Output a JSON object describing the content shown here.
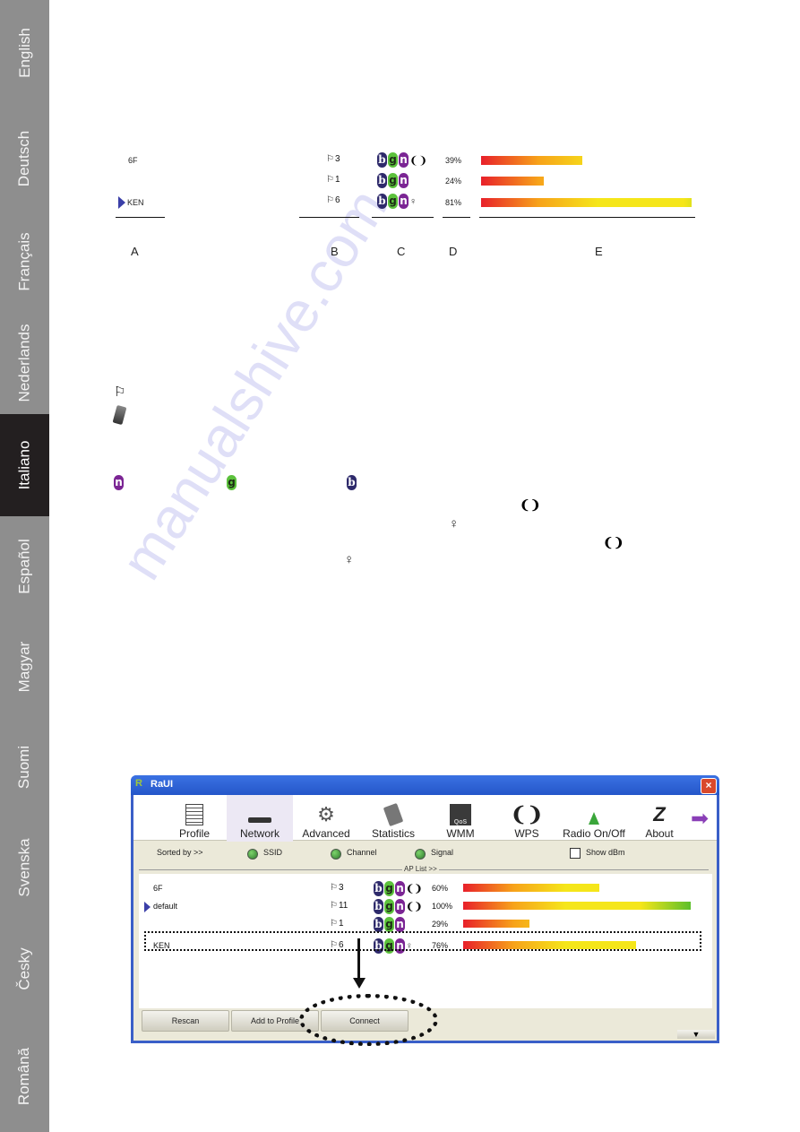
{
  "sidebar": {
    "languages": [
      {
        "label": "English",
        "active": false
      },
      {
        "label": "Deutsch",
        "active": false
      },
      {
        "label": "Français",
        "active": false
      },
      {
        "label": "Nederlands",
        "active": false
      },
      {
        "label": "Italiano",
        "active": true
      },
      {
        "label": "Español",
        "active": false
      },
      {
        "label": "Magyar",
        "active": false
      },
      {
        "label": "Suomi",
        "active": false
      },
      {
        "label": "Svenska",
        "active": false
      },
      {
        "label": "Česky",
        "active": false
      },
      {
        "label": "Română",
        "active": false
      }
    ]
  },
  "watermark": "manualshive.com",
  "diagram": {
    "rows": [
      {
        "ssid": "6F",
        "selected": false,
        "channel": "3",
        "modes": [
          "b",
          "g",
          "n"
        ],
        "extra": "wps",
        "signal": "39%",
        "signal_pct": 39
      },
      {
        "ssid": "",
        "selected": false,
        "channel": "1",
        "modes": [
          "b",
          "g",
          "n"
        ],
        "extra": "",
        "signal": "24%",
        "signal_pct": 24
      },
      {
        "ssid": "KEN",
        "selected": true,
        "channel": "6",
        "modes": [
          "b",
          "g",
          "n"
        ],
        "extra": "key",
        "signal": "81%",
        "signal_pct": 81
      }
    ],
    "column_letters": [
      "A",
      "B",
      "C",
      "D",
      "E"
    ]
  },
  "legend_icons": [
    "infrastructure-ap-icon",
    "adhoc-card-icon",
    "mode-n-badge",
    "mode-g-badge",
    "mode-b-badge",
    "wps-icon",
    "key-icon",
    "wps-icon",
    "key-icon"
  ],
  "badges": {
    "b": "b",
    "g": "g",
    "n": "n"
  },
  "window": {
    "title": "RaUI",
    "logo": "R",
    "close": "×",
    "toolbar": [
      {
        "label": "Profile",
        "icon": "profile-icon",
        "active": false
      },
      {
        "label": "Network",
        "icon": "network-router-icon",
        "active": true
      },
      {
        "label": "Advanced",
        "icon": "gears-icon",
        "active": false
      },
      {
        "label": "Statistics",
        "icon": "calculator-icon",
        "active": false
      },
      {
        "label": "WMM",
        "icon": "qos-icon",
        "active": false
      },
      {
        "label": "WPS",
        "icon": "wps-icon",
        "active": false
      },
      {
        "label": "Radio On/Off",
        "icon": "radio-icon",
        "active": false
      },
      {
        "label": "About",
        "icon": "about-icon",
        "active": false
      }
    ],
    "next_arrow": "➡",
    "sort": {
      "label": "Sorted by >>",
      "options": [
        "SSID",
        "Channel",
        "Signal"
      ],
      "show_dbm_label": "Show dBm",
      "show_dbm_checked": false
    },
    "ap_list_label": "AP List >>",
    "ap_rows": [
      {
        "ssid": "6F",
        "selected": false,
        "channel": "3",
        "extra": "wps",
        "signal": "60%",
        "signal_pct": 60
      },
      {
        "ssid": "default",
        "selected": true,
        "channel": "11",
        "extra": "wps",
        "signal": "100%",
        "signal_pct": 100
      },
      {
        "ssid": "",
        "selected": false,
        "channel": "1",
        "extra": "",
        "signal": "29%",
        "signal_pct": 29
      },
      {
        "ssid": "KEN",
        "selected": false,
        "channel": "6",
        "extra": "key",
        "signal": "76%",
        "signal_pct": 76
      }
    ],
    "buttons": {
      "rescan": "Rescan",
      "add_to_profile": "Add to Profile",
      "connect": "Connect"
    },
    "expand_icon": "▼"
  },
  "colors": {
    "sidebar_bg": "#8e8e8e",
    "sidebar_active": "#231f20",
    "badge_b": "#2e2a6b",
    "badge_g": "#5cc13c",
    "badge_n": "#7b2594",
    "bar_start": "#e8202a",
    "bar_mid": "#f5e61a",
    "bar_end": "#5cbf2a"
  }
}
